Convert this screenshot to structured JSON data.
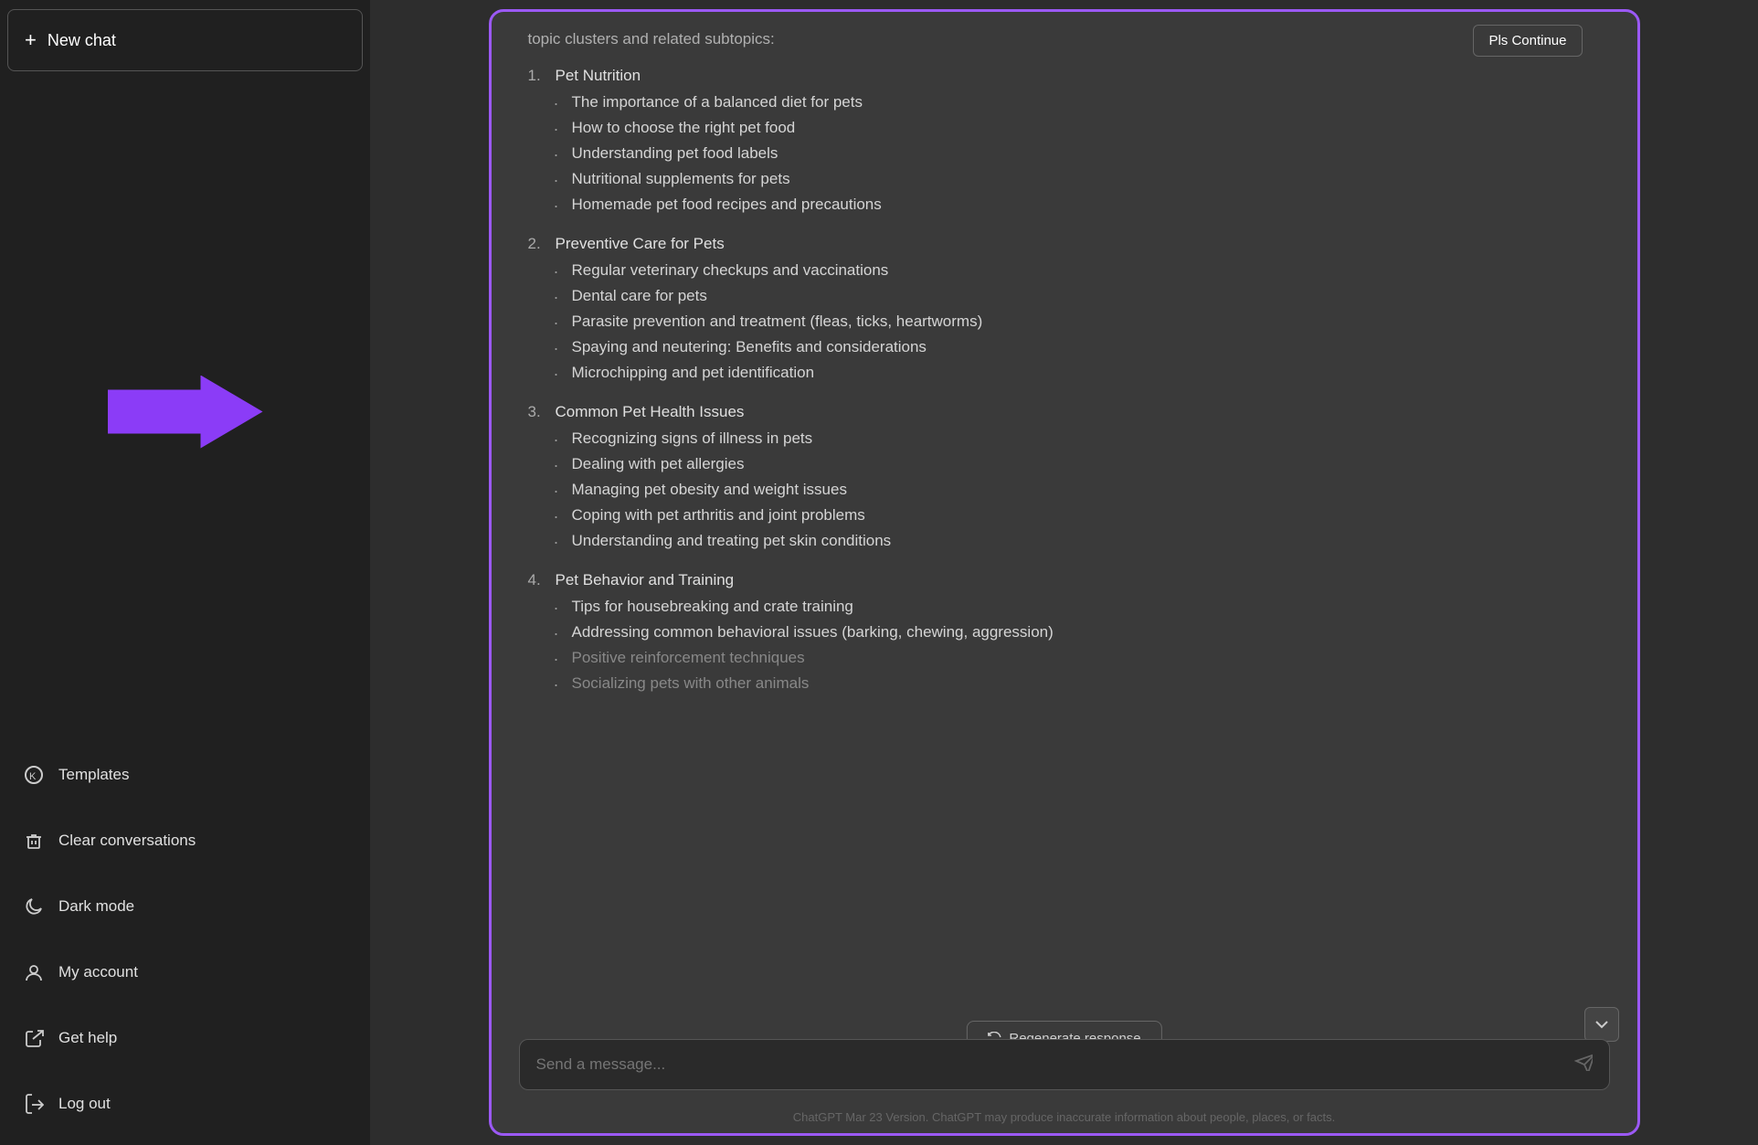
{
  "sidebar": {
    "new_chat_label": "New chat",
    "items": [
      {
        "id": "templates",
        "label": "Templates",
        "icon": "⊛"
      },
      {
        "id": "clear",
        "label": "Clear conversations",
        "icon": "🗑"
      },
      {
        "id": "dark",
        "label": "Dark mode",
        "icon": "☽"
      },
      {
        "id": "account",
        "label": "My account",
        "icon": "○"
      },
      {
        "id": "help",
        "label": "Get help",
        "icon": "↗"
      },
      {
        "id": "logout",
        "label": "Log out",
        "icon": "→"
      }
    ]
  },
  "chat": {
    "truncated_text": "topic clusters and related subtopics:",
    "pls_continue_label": "Pls Continue",
    "sections": [
      {
        "num": "1.",
        "title": "Pet Nutrition",
        "subtopics": [
          {
            "text": "The importance of a balanced diet for pets",
            "faded": false
          },
          {
            "text": "How to choose the right pet food",
            "faded": false
          },
          {
            "text": "Understanding pet food labels",
            "faded": false
          },
          {
            "text": "Nutritional supplements for pets",
            "faded": false
          },
          {
            "text": "Homemade pet food recipes and precautions",
            "faded": false
          }
        ]
      },
      {
        "num": "2.",
        "title": "Preventive Care for Pets",
        "subtopics": [
          {
            "text": "Regular veterinary checkups and vaccinations",
            "faded": false
          },
          {
            "text": "Dental care for pets",
            "faded": false
          },
          {
            "text": "Parasite prevention and treatment (fleas, ticks, heartworms)",
            "faded": false
          },
          {
            "text": "Spaying and neutering: Benefits and considerations",
            "faded": false
          },
          {
            "text": "Microchipping and pet identification",
            "faded": false
          }
        ]
      },
      {
        "num": "3.",
        "title": "Common Pet Health Issues",
        "subtopics": [
          {
            "text": "Recognizing signs of illness in pets",
            "faded": false
          },
          {
            "text": "Dealing with pet allergies",
            "faded": false
          },
          {
            "text": "Managing pet obesity and weight issues",
            "faded": false
          },
          {
            "text": "Coping with pet arthritis and joint problems",
            "faded": false
          },
          {
            "text": "Understanding and treating pet skin conditions",
            "faded": false
          }
        ]
      },
      {
        "num": "4.",
        "title": "Pet Behavior and Training",
        "subtopics": [
          {
            "text": "Tips for housebreaking and crate training",
            "faded": false
          },
          {
            "text": "Addressing common behavioral issues (barking, chewing, aggression)",
            "faded": false
          },
          {
            "text": "Positive reinforcement techniques",
            "faded": true
          },
          {
            "text": "Socializing pets with other animals",
            "faded": true
          }
        ]
      }
    ],
    "regenerate_label": "Regenerate response",
    "input_placeholder": "Send a message...",
    "footer_text": "ChatGPT Mar 23 Version. ChatGPT may produce inaccurate information about people, places, or facts."
  }
}
